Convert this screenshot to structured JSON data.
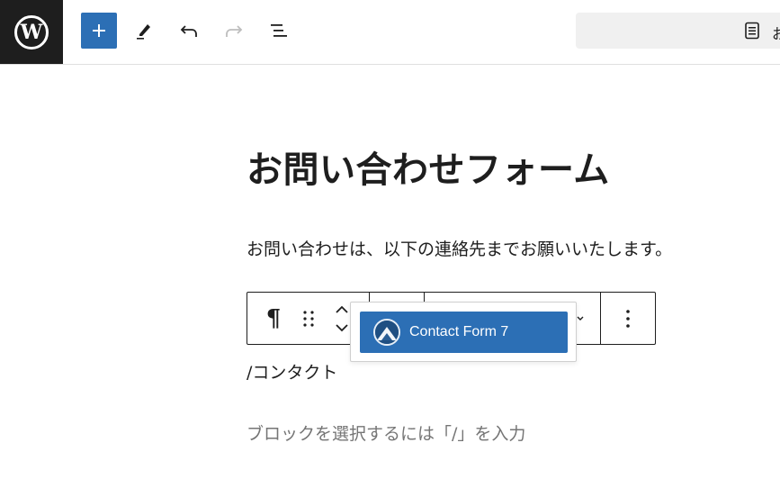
{
  "toolbar": {
    "logo_letter": "W",
    "document_title": "お"
  },
  "editor": {
    "post_title": "お問い合わせフォーム",
    "paragraph": "お問い合わせは、以下の連絡先までお願いいたします。",
    "slash_input": "/コンタクト",
    "placeholder": "ブロックを選択するには「/」を入力"
  },
  "block_toolbar": {
    "block_type_symbol": "¶"
  },
  "autocomplete": {
    "items": [
      {
        "label": "Contact Form 7",
        "icon": "cf7-mountain-icon"
      }
    ]
  },
  "colors": {
    "accent": "#2c6fb5",
    "logo_bg": "#1e1e1e",
    "placeholder": "#757575"
  }
}
